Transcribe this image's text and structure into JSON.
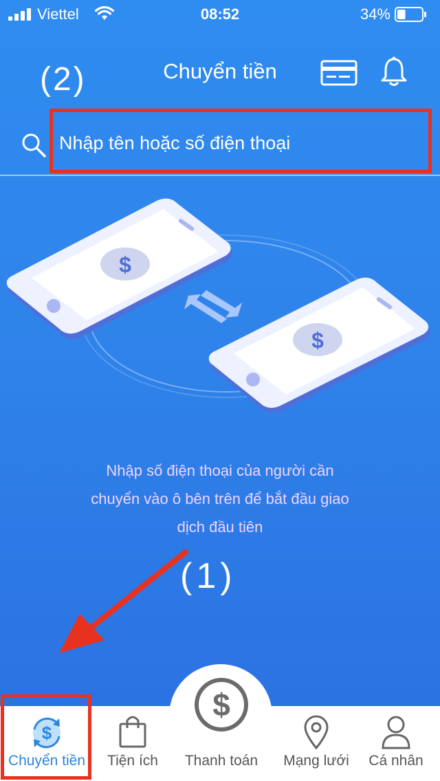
{
  "status_bar": {
    "carrier": "Viettel",
    "time": "08:52",
    "battery": "34%",
    "battery_level": 0.34
  },
  "header": {
    "title": "Chuyển tiền",
    "annotation": "(2)",
    "icons": [
      "card-icon",
      "bell-icon"
    ]
  },
  "search": {
    "placeholder": "Nhập tên hoặc số điện thoại",
    "value": ""
  },
  "empty_state": {
    "message_lines": [
      "Nhập số điện thoại của người cần",
      "chuyển vào ô bên trên để bắt đầu giao",
      "dịch đầu tiên"
    ],
    "annotation": "(1)"
  },
  "tabs": [
    {
      "label": "Chuyển tiền",
      "icon": "transfer-icon",
      "active": true
    },
    {
      "label": "Tiện ích",
      "icon": "shopping-bag-icon",
      "active": false
    },
    {
      "label": "Thanh toán",
      "icon": "dollar-icon",
      "active": false
    },
    {
      "label": "Mạng lưới",
      "icon": "location-pin-icon",
      "active": false
    },
    {
      "label": "Cá nhân",
      "icon": "person-icon",
      "active": false
    }
  ],
  "colors": {
    "accent": "#2a86e0",
    "annotation_red": "#e8321f",
    "message_text": "#f0d4ff"
  }
}
